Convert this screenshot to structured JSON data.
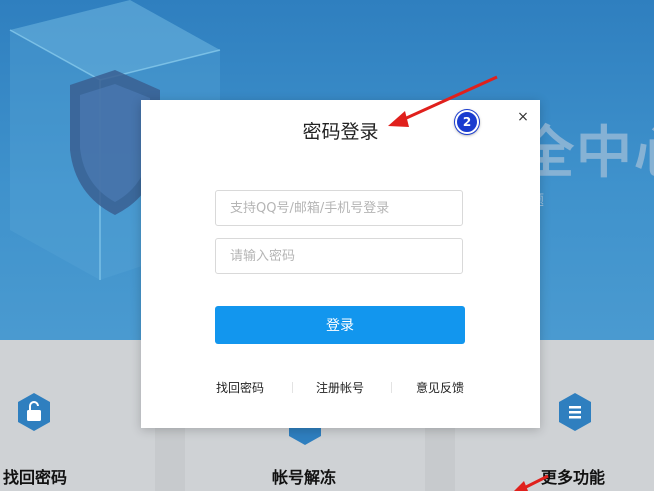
{
  "background": {
    "hero_title": "全中心",
    "hero_sub": "题",
    "features": [
      {
        "label": "找回密码",
        "icon": "unlock-icon"
      },
      {
        "label": "帐号解冻",
        "icon": "snowflake-icon"
      },
      {
        "label": "更多功能",
        "icon": "menu-icon"
      }
    ]
  },
  "modal": {
    "title": "密码登录",
    "close_glyph": "×",
    "account_placeholder": "支持QQ号/邮箱/手机号登录",
    "password_placeholder": "请输入密码",
    "login_label": "登录",
    "links": [
      "找回密码",
      "注册帐号",
      "意见反馈"
    ]
  },
  "annotation": {
    "badge_number": "2",
    "arrow_color": "#e0201c",
    "badge_color": "#1a3ccf"
  }
}
